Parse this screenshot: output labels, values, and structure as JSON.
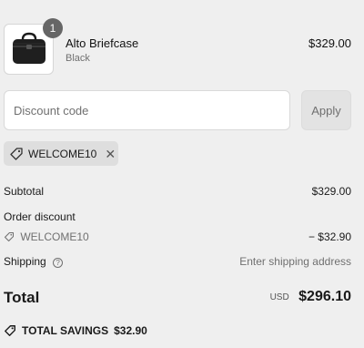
{
  "line_item": {
    "quantity": "1",
    "name": "Alto Briefcase",
    "variant": "Black",
    "price": "$329.00",
    "image_icon": "briefcase-icon"
  },
  "discount": {
    "placeholder": "Discount code",
    "apply_label": "Apply",
    "applied_code": "WELCOME10"
  },
  "summary": {
    "subtotal_label": "Subtotal",
    "subtotal_value": "$329.00",
    "order_discount_label": "Order discount",
    "discount_code": "WELCOME10",
    "discount_value": "− $32.90",
    "shipping_label": "Shipping",
    "shipping_value": "Enter shipping address",
    "total_label": "Total",
    "currency": "USD",
    "total_value": "$296.10",
    "savings_label": "TOTAL SAVINGS",
    "savings_value": "$32.90"
  },
  "colors": {
    "background": "#efefef",
    "badge": "#666666",
    "tag_background": "#dedede"
  }
}
